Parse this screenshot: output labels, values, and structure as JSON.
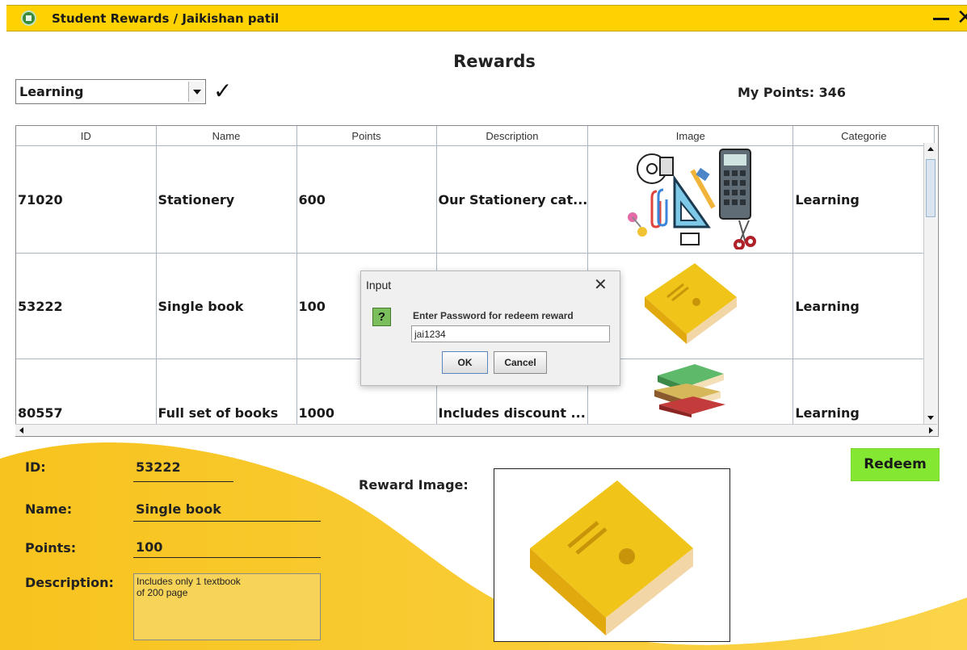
{
  "window": {
    "title": "Student Rewards /  Jaikishan patil",
    "minimize_icon": "minimize-icon",
    "close_icon": "close-icon",
    "close_glyph": "✕",
    "accent_color": "#ffd200"
  },
  "header": {
    "title": "Rewards",
    "category_selected": "Learning",
    "points_label": "My Points: 346"
  },
  "table": {
    "columns": [
      "ID",
      "Name",
      "Points",
      "Description",
      "Image",
      "Categorie"
    ],
    "rows": [
      {
        "id": "71020",
        "name": "Stationery",
        "points": "600",
        "description": "Our Stationery cat...",
        "image": "stationery-image",
        "category": "Learning"
      },
      {
        "id": "53222",
        "name": "Single book",
        "points": "100",
        "description": "",
        "image": "book-image",
        "category": "Learning"
      },
      {
        "id": "80557",
        "name": "Full set of books",
        "points": "1000",
        "description": "Includes discount ...",
        "image": "books-stack-image",
        "category": "Learning"
      }
    ]
  },
  "details": {
    "id_label": "ID:",
    "id_value": "53222",
    "name_label": "Name:",
    "name_value": "Single book",
    "points_label": "Points:",
    "points_value": "100",
    "description_label": "Description:",
    "description_value": "Includes only 1 textbook\nof 200 page",
    "image_label": "Reward Image:",
    "redeem_label": "Redeem",
    "redeem_color": "#84e832"
  },
  "dialog": {
    "title": "Input",
    "close_glyph": "✕",
    "message": "Enter Password for redeem reward",
    "input_value": "jai1234",
    "ok_label": "OK",
    "cancel_label": "Cancel",
    "question_glyph": "?"
  }
}
